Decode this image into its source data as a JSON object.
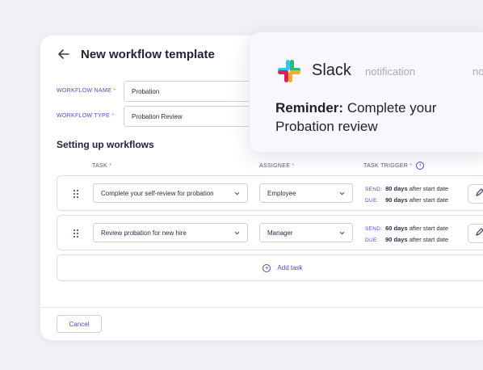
{
  "page": {
    "title": "New workflow template",
    "fields": [
      {
        "label": "WORKFLOW NAME",
        "required": "*",
        "value": "Probation"
      },
      {
        "label": "WORKFLOW TYPE",
        "required": "*",
        "value": "Probation Review"
      }
    ],
    "section_title": "Setting up workflows",
    "columns": {
      "task": "TASK",
      "assignee": "ASSIGNEE",
      "trigger": "TASK TRIGGER",
      "required": "*",
      "info_icon": "i"
    },
    "rows": [
      {
        "task": "Complete your self-review for probation",
        "assignee": "Employee",
        "send_label": "SEND:",
        "send_days": "80 days",
        "send_rest": "after start date",
        "due_label": "DUE:",
        "due_days": "90 days",
        "due_rest": "after start date"
      },
      {
        "task": "Review probation for new hire",
        "assignee": "Manager",
        "send_label": "SEND:",
        "send_days": "60 days",
        "send_rest": "after start date",
        "due_label": "DUE:",
        "due_days": "90 days",
        "due_rest": "after start date"
      }
    ],
    "add_task": "Add task",
    "add_task_icon": "+",
    "cancel": "Cancel"
  },
  "notification": {
    "app": "Slack",
    "type": "notification",
    "type_overflow": "no",
    "message_bold": "Reminder:",
    "message_rest": "Complete your Probation review"
  },
  "colors": {
    "accent": "#4a4ad0",
    "required": "#ff6b6b",
    "background": "#f0f0f5",
    "slack_blue": "#36C5F0",
    "slack_green": "#2EB67D",
    "slack_yellow": "#ECB22E",
    "slack_red": "#E01E5A"
  },
  "icons": [
    "arrow-left-icon",
    "drag-handle-icon",
    "chevron-down-icon",
    "pencil-icon",
    "info-icon",
    "plus-circle-icon",
    "slack-logo-icon"
  ]
}
